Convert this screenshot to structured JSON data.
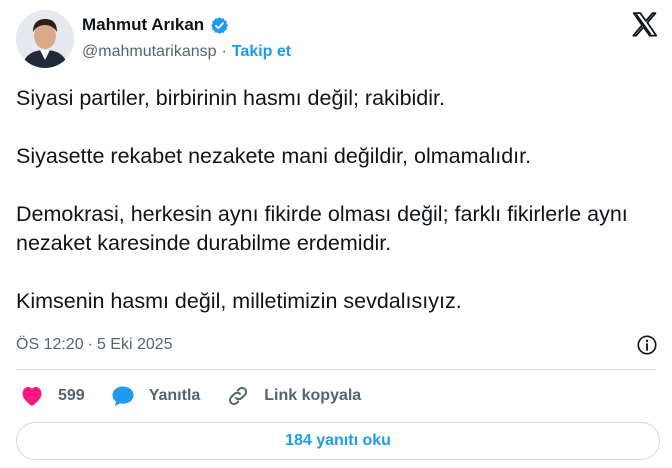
{
  "author": {
    "display_name": "Mahmut Arıkan",
    "handle": "@mahmutarikansp",
    "separator": "·",
    "follow_label": "Takip et",
    "verified": true
  },
  "tweet": {
    "paragraphs": [
      "Siyasi partiler, birbirinin hasmı değil; rakibidir.",
      "Siyasette rekabet nezakete mani değildir, olmamalıdır.",
      "Demokrasi, herkesin aynı fikirde olması değil; farklı fikirlerle aynı nezaket karesinde durabilme erdemidir.",
      "Kimsenin hasmı değil, milletimizin sevdalısıyız."
    ],
    "time": "ÖS 12:20",
    "separator": "·",
    "date": "5 Eki 2025"
  },
  "actions": {
    "like_count": "599",
    "reply_label": "Yanıtla",
    "copy_link_label": "Link kopyala"
  },
  "replies_button_label": "184 yanıtı oku",
  "icons": {
    "avatar": "avatar",
    "verified": "verified-badge-icon",
    "x_logo": "x-logo-icon",
    "info": "info-icon",
    "heart": "heart-icon",
    "reply": "reply-bubble-icon",
    "link": "link-icon"
  },
  "colors": {
    "accent": "#1d9bf0",
    "like": "#f91880",
    "secondary_text": "#536471",
    "text": "#0f1419",
    "border": "#cfd9de"
  }
}
